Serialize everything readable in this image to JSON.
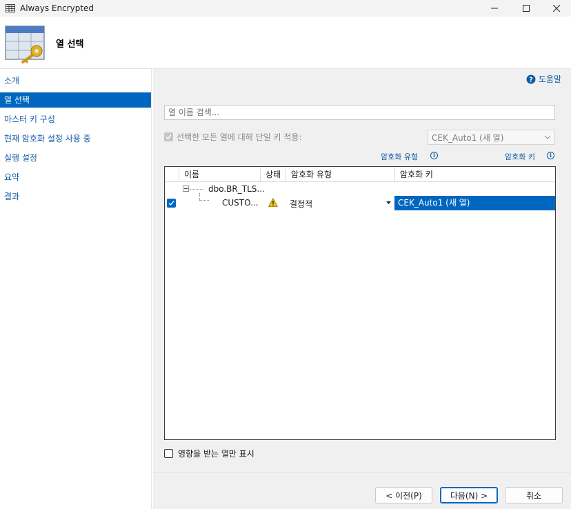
{
  "window": {
    "title": "Always Encrypted",
    "minimize_glyph": "—",
    "maximize_glyph": "☐",
    "close_glyph": "✕"
  },
  "header": {
    "page_title": "열 선택",
    "icon": "table-key-icon"
  },
  "sidebar": {
    "items": [
      {
        "label": "소개",
        "active": false
      },
      {
        "label": "열 선택",
        "active": true
      },
      {
        "label": "마스터 키 구성",
        "active": false
      },
      {
        "label": "현재 암호화 설정 사용 중",
        "active": false
      },
      {
        "label": "실행 설정",
        "active": false
      },
      {
        "label": "요약",
        "active": false
      },
      {
        "label": "결과",
        "active": false
      }
    ]
  },
  "main": {
    "help_label": "도움말",
    "search_placeholder": "열 이름 검색...",
    "single_key": {
      "label": "선택한 모든 열에 대해 단일 키 적용:",
      "checked": true,
      "enabled": false
    },
    "single_key_select": {
      "value": "CEK_Auto1 (새 열)",
      "enabled": false
    },
    "links": {
      "encryption_type": "암호화 유형",
      "encryption_key": "암호화 키"
    },
    "grid": {
      "columns": [
        "이름",
        "상태",
        "암호화 유형",
        "암호화 키"
      ],
      "parent_row": {
        "name": "dbo.BR_TLS..."
      },
      "child_row": {
        "checked": true,
        "name": "CUSTO...",
        "status_icon": "warning-icon",
        "encryption_type": "결정적",
        "encryption_key": "CEK_Auto1 (새 열)"
      }
    },
    "show_affected": {
      "label": "영향을 받는 열만 표시",
      "checked": false
    }
  },
  "footer": {
    "prev_label": "< 이전(P)",
    "next_label": "다음(N) >",
    "cancel_label": "취소"
  },
  "colors": {
    "accent": "#0067c0",
    "link": "#0f5aa6",
    "panel_bg": "#f0f0f0",
    "warning": "#f2c500"
  }
}
